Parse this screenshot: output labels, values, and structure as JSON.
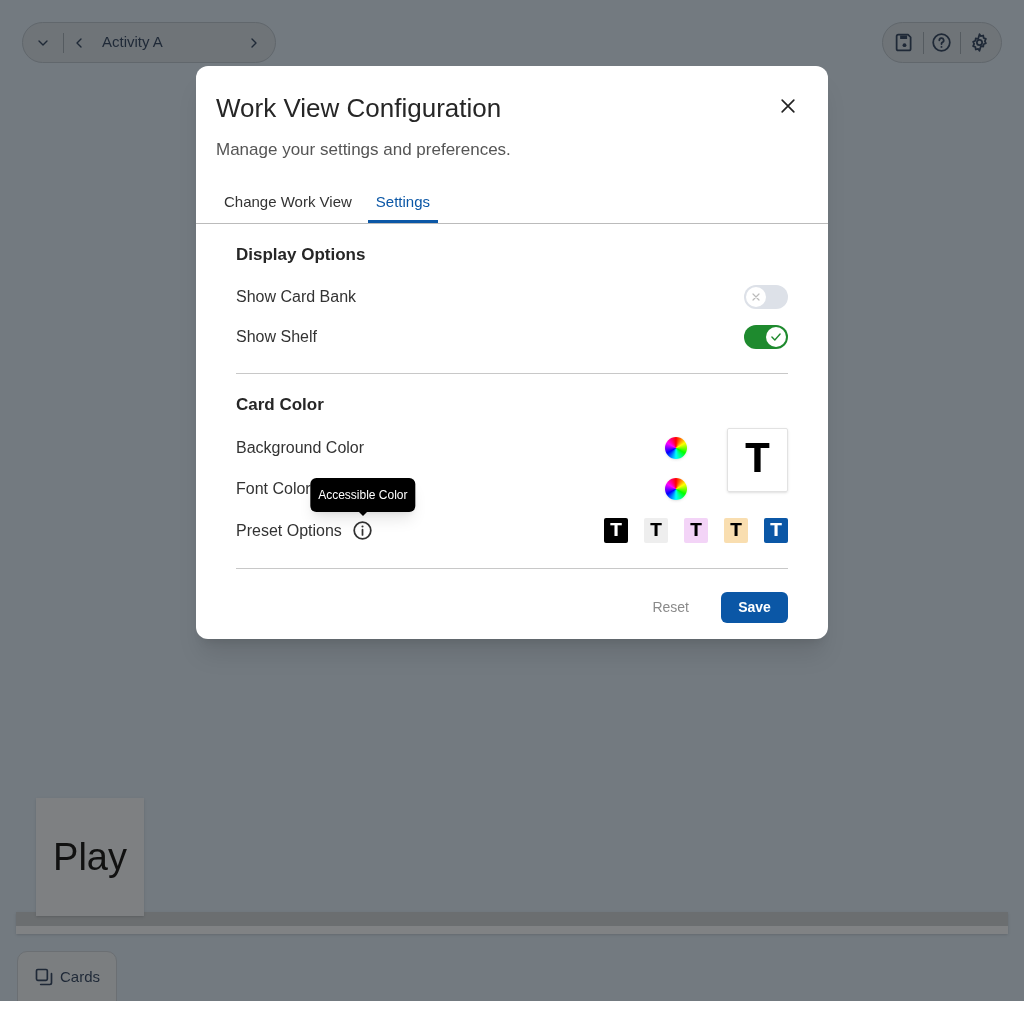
{
  "toolbar": {
    "activity": "Activity A"
  },
  "dialog": {
    "title": "Work View Configuration",
    "subtitle": "Manage your settings and preferences.",
    "tabs": [
      {
        "label": "Change Work View",
        "selected": false
      },
      {
        "label": "Settings",
        "selected": true
      }
    ],
    "sections": [
      {
        "heading": "Display Options",
        "rows": [
          {
            "kind": "toggle",
            "label": "Show Card Bank",
            "on": false
          },
          {
            "kind": "toggle",
            "label": "Show Shelf",
            "on": true
          }
        ]
      },
      {
        "heading": "Card Color",
        "rows": [
          {
            "kind": "color",
            "label": "Background Color"
          },
          {
            "kind": "color",
            "label": "Font Color"
          },
          {
            "kind": "presets",
            "label": "Preset Options",
            "tooltip": "Accessible Color",
            "presets": [
              {
                "glyph": "T",
                "color": "#000000"
              },
              {
                "glyph": "T",
                "color": "#eeeeee"
              },
              {
                "glyph": "T",
                "color": "#f3d4f7"
              },
              {
                "glyph": "T",
                "color": "#f9deb0"
              },
              {
                "glyph": "T",
                "color": "#0b57a6"
              }
            ]
          }
        ]
      }
    ],
    "preview": {
      "glyph": "T"
    },
    "buttons": {
      "reset": "Reset",
      "save": "Save"
    }
  },
  "shelf_card": "Play",
  "cards_button": "Cards"
}
